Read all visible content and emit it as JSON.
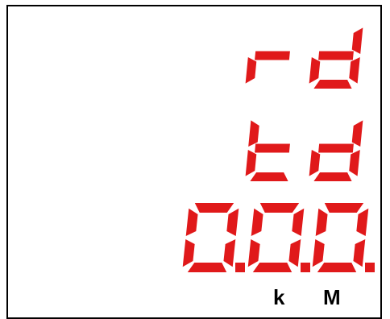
{
  "display": {
    "rows": [
      {
        "text": "rd",
        "segments": [
          [
            "e",
            "g"
          ],
          [
            "b",
            "c",
            "d",
            "e",
            "g"
          ]
        ],
        "dots": [
          false,
          false
        ]
      },
      {
        "text": "td",
        "segments": [
          [
            "d",
            "e",
            "f",
            "g"
          ],
          [
            "b",
            "c",
            "d",
            "e",
            "g"
          ]
        ],
        "dots": [
          false,
          false
        ]
      },
      {
        "text": "0.0.0.",
        "segments": [
          [
            "a",
            "b",
            "c",
            "d",
            "e",
            "f"
          ],
          [
            "a",
            "b",
            "c",
            "d",
            "e",
            "f"
          ],
          [
            "a",
            "b",
            "c",
            "d",
            "e",
            "f"
          ]
        ],
        "dots": [
          true,
          true,
          true
        ]
      }
    ],
    "color": "#e0191a"
  },
  "units": {
    "k": "k",
    "m": "M"
  }
}
